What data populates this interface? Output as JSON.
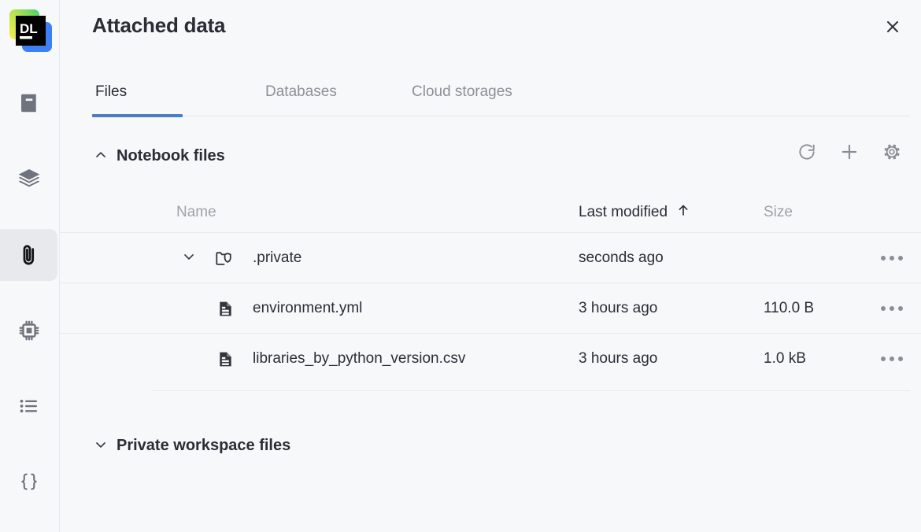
{
  "app": {
    "logo_text": "DL",
    "logo_colors": {
      "green": "#41d66c",
      "yellow": "#f9f057",
      "blue": "#3d7ff5",
      "dark": "#000000"
    }
  },
  "rail": {
    "items": [
      {
        "name": "notebook-icon",
        "label": "Notebook",
        "selected": false
      },
      {
        "name": "layers-icon",
        "label": "Layers",
        "selected": false
      },
      {
        "name": "attached-data-icon",
        "label": "Attached data",
        "selected": true
      },
      {
        "name": "compute-icon",
        "label": "Compute",
        "selected": false
      },
      {
        "name": "outline-icon",
        "label": "Outline",
        "selected": false
      },
      {
        "name": "variables-icon",
        "label": "Variables",
        "selected": false
      }
    ]
  },
  "header": {
    "title": "Attached data",
    "close_icon": "close-icon"
  },
  "tabs": {
    "items": [
      {
        "label": "Files",
        "active": true
      },
      {
        "label": "Databases",
        "active": false
      },
      {
        "label": "Cloud storages",
        "active": false
      }
    ],
    "accent_color": "#4a7ec0"
  },
  "sections": [
    {
      "title": "Notebook files",
      "expanded": true,
      "chevron_icon": "chevron-up-icon",
      "actions": [
        {
          "name": "refresh-icon",
          "label": "Refresh"
        },
        {
          "name": "plus-icon",
          "label": "Add"
        },
        {
          "name": "gear-icon",
          "label": "Settings"
        }
      ],
      "columns": [
        {
          "key": "name",
          "label": "Name",
          "sorted": false
        },
        {
          "key": "modified",
          "label": "Last modified",
          "sorted": true,
          "sort_direction": "asc",
          "sort_icon": "arrow-up-icon"
        },
        {
          "key": "size",
          "label": "Size",
          "sorted": false
        }
      ],
      "rows": [
        {
          "type": "folder",
          "icon": "folder-private-icon",
          "chevron_icon": "chevron-down-icon",
          "expanded": true,
          "name": ".private",
          "modified": "seconds ago",
          "size": "",
          "more_icon": "more-icon"
        },
        {
          "type": "file",
          "icon": "file-icon",
          "name": "environment.yml",
          "modified": "3 hours ago",
          "size": "110.0 B",
          "more_icon": "more-icon"
        },
        {
          "type": "file",
          "icon": "file-icon",
          "name": "libraries_by_python_version.csv",
          "modified": "3 hours ago",
          "size": "1.0 kB",
          "more_icon": "more-icon"
        }
      ]
    },
    {
      "title": "Private workspace files",
      "expanded": false,
      "chevron_icon": "chevron-down-icon",
      "actions": [],
      "columns": [],
      "rows": []
    }
  ]
}
